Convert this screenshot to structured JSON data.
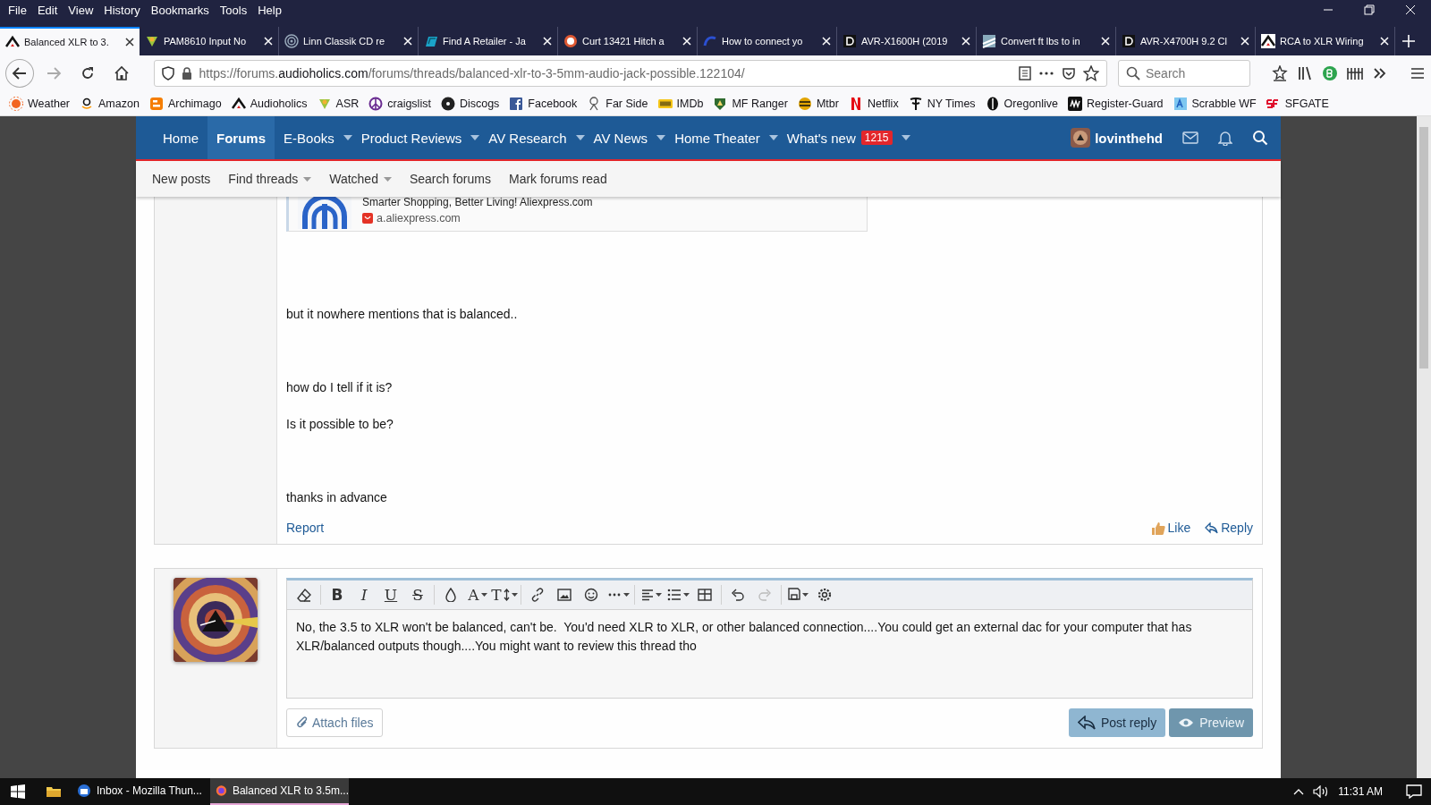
{
  "menu_bar": {
    "items": [
      "File",
      "Edit",
      "View",
      "History",
      "Bookmarks",
      "Tools",
      "Help"
    ]
  },
  "tabs": [
    {
      "title": "Balanced XLR to 3.",
      "selected": true
    },
    {
      "title": "PAM8610 Input No",
      "selected": false
    },
    {
      "title": "Linn Classik CD re",
      "selected": false
    },
    {
      "title": "Find A Retailer - Ja",
      "selected": false
    },
    {
      "title": "Curt 13421 Hitch a",
      "selected": false
    },
    {
      "title": "How to connect yo",
      "selected": false
    },
    {
      "title": "AVR-X1600H (2019",
      "selected": false
    },
    {
      "title": "Convert ft lbs to in",
      "selected": false
    },
    {
      "title": "AVR-X4700H 9.2 Cl",
      "selected": false
    },
    {
      "title": "RCA to XLR Wiring",
      "selected": false
    }
  ],
  "address_bar": {
    "url_start": "https://forums.",
    "url_domain": "audioholics.com",
    "url_path": "/forums/threads/balanced-xlr-to-3-5mm-audio-jack-possible.122104/"
  },
  "search_field": {
    "placeholder": "Search"
  },
  "bookmarks": [
    "Weather",
    "Amazon",
    "Archimago",
    "Audioholics",
    "ASR",
    "craigslist",
    "Discogs",
    "Facebook",
    "Far Side",
    "IMDb",
    "MF Ranger",
    "Mtbr",
    "Netflix",
    "NY Times",
    "Oregonlive",
    "Register-Guard",
    "Scrabble WF",
    "SFGATE"
  ],
  "forum_nav": {
    "items": [
      {
        "label": "Home",
        "selected": false,
        "dropdown": false
      },
      {
        "label": "Forums",
        "selected": true,
        "dropdown": false
      },
      {
        "label": "E-Books",
        "selected": false,
        "dropdown": true
      },
      {
        "label": "Product Reviews",
        "selected": false,
        "dropdown": true
      },
      {
        "label": "AV Research",
        "selected": false,
        "dropdown": true
      },
      {
        "label": "AV News",
        "selected": false,
        "dropdown": true
      },
      {
        "label": "Home Theater",
        "selected": false,
        "dropdown": true
      },
      {
        "label": "What's new",
        "selected": false,
        "dropdown": true,
        "badge": "1215"
      }
    ],
    "user": "lovinthehd"
  },
  "sub_nav": [
    {
      "label": "New posts",
      "dropdown": false
    },
    {
      "label": "Find threads",
      "dropdown": true
    },
    {
      "label": "Watched",
      "dropdown": true
    },
    {
      "label": "Search forums",
      "dropdown": false
    },
    {
      "label": "Mark forums read",
      "dropdown": false
    }
  ],
  "post": {
    "link_preview": {
      "title": "Smarter Shopping, Better Living! Aliexpress.com",
      "domain": "a.aliexpress.com"
    },
    "paragraphs": [
      "but it nowhere mentions that is balanced..",
      "how do I tell if it is?",
      "Is it possible to be?",
      "thanks in advance"
    ],
    "report": "Report",
    "like": "Like",
    "reply": "Reply"
  },
  "reply_editor": {
    "letter_buttons": [
      "B",
      "I",
      "U",
      "S",
      "A",
      "T"
    ],
    "text": "No, the 3.5 to XLR won't be balanced, can't be.  You'd need XLR to XLR, or other balanced connection....You could get an external dac for your computer that has XLR/balanced outputs though....You might want to review this thread tho",
    "attach": "Attach files",
    "post_reply": "Post reply",
    "preview": "Preview"
  },
  "taskbar": {
    "apps": [
      {
        "title": "Inbox - Mozilla Thun...",
        "selected": false
      },
      {
        "title": "Balanced XLR to 3.5m...",
        "selected": true
      }
    ],
    "clock": "11:31 AM"
  }
}
